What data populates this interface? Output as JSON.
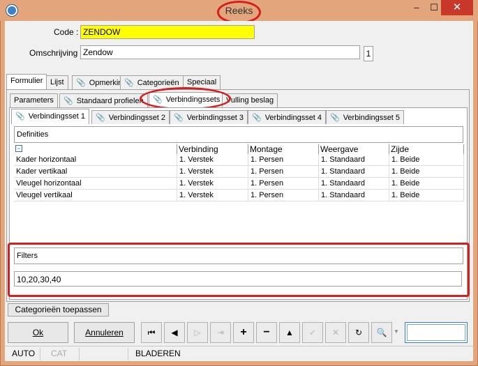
{
  "window": {
    "title": "Reeks",
    "min_icon": "minimize-icon",
    "max_icon": "maximize-icon",
    "close_icon": "close-icon"
  },
  "form": {
    "code_label": "Code :",
    "code_value": "ZENDOW",
    "description_label": "Omschrijving :",
    "description_value": "Zendow",
    "language_index": "1"
  },
  "main_tabs": [
    "Formulier",
    "Lijst",
    "Opmerking",
    "Categorieën",
    "Speciaal"
  ],
  "sub_tabs": [
    "Parameters",
    "Standaard profielen",
    "Verbindingssets",
    "Vulling beslag"
  ],
  "set_tabs": [
    "Verbindingsset 1",
    "Verbindingsset 2",
    "Verbindingsset 3",
    "Verbindingsset 4",
    "Verbindingsset 5"
  ],
  "definitions_header": "Definities",
  "grid": {
    "columns": [
      "Verbinding",
      "Montage",
      "Weergave",
      "Zijde"
    ],
    "rows": [
      {
        "name": "Kader horizontaal",
        "verbinding": "1. Verstek",
        "montage": "1. Persen",
        "weergave": "1. Standaard",
        "zijde": "1. Beide"
      },
      {
        "name": "Kader vertikaal",
        "verbinding": "1. Verstek",
        "montage": "1. Persen",
        "weergave": "1. Standaard",
        "zijde": "1. Beide"
      },
      {
        "name": "Vleugel horizontaal",
        "verbinding": "1. Verstek",
        "montage": "1. Persen",
        "weergave": "1. Standaard",
        "zijde": "1. Beide"
      },
      {
        "name": "Vleugel vertikaal",
        "verbinding": "1. Verstek",
        "montage": "1. Persen",
        "weergave": "1. Standaard",
        "zijde": "1. Beide"
      }
    ]
  },
  "filters": {
    "label": "Filters",
    "value": "10,20,30,40"
  },
  "buttons": {
    "apply_categories": "Categorieën toepassen",
    "ok": "Ok",
    "cancel": "Annuleren"
  },
  "status": {
    "mode1": "AUTO",
    "mode2": "CAT",
    "state": "BLADEREN"
  },
  "colors": {
    "code_highlight": "#ffff00",
    "annotation_red": "#d41f1f",
    "title_bar": "#e3a57b"
  }
}
